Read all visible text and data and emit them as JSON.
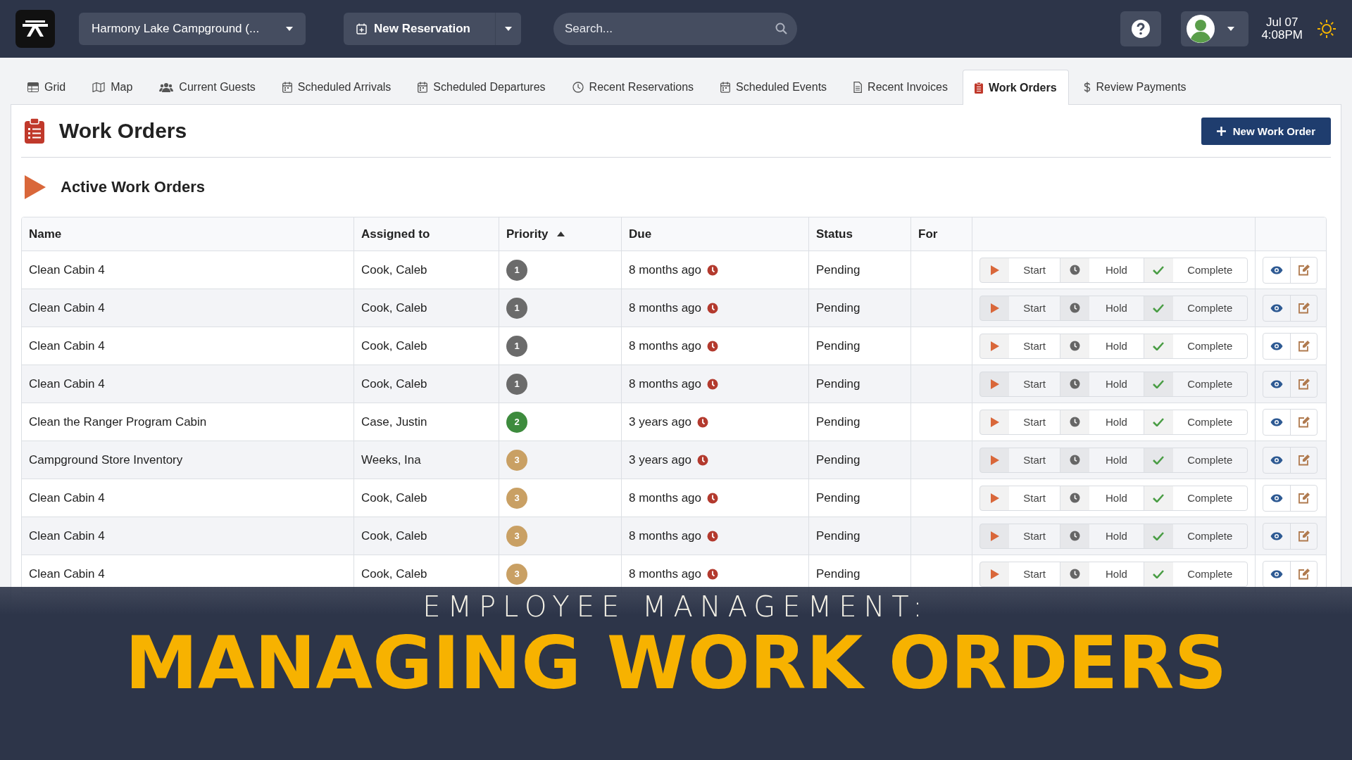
{
  "topbar": {
    "campground": "Harmony Lake Campground (...",
    "new_reservation": "New Reservation",
    "search": {
      "placeholder": "Search..."
    },
    "date": "Jul 07",
    "time": "4:08PM"
  },
  "tabs": [
    {
      "label": "Grid",
      "kind": "grid",
      "selected": false
    },
    {
      "label": "Map",
      "kind": "map",
      "selected": false
    },
    {
      "label": "Current Guests",
      "kind": "users",
      "selected": false
    },
    {
      "label": "Scheduled Arrivals",
      "kind": "calendar",
      "selected": false
    },
    {
      "label": "Scheduled Departures",
      "kind": "calendar",
      "selected": false
    },
    {
      "label": "Recent Reservations",
      "kind": "clock",
      "selected": false
    },
    {
      "label": "Scheduled Events",
      "kind": "calendar",
      "selected": false
    },
    {
      "label": "Recent Invoices",
      "kind": "document",
      "selected": false
    },
    {
      "label": "Work Orders",
      "kind": "clipboard",
      "selected": true
    },
    {
      "label": "Review Payments",
      "kind": "dollar",
      "selected": false
    }
  ],
  "page": {
    "title": "Work Orders",
    "new_button": "New Work Order",
    "section_title": "Active Work Orders"
  },
  "table": {
    "columns": [
      "Name",
      "Assigned to",
      "Priority",
      "Due",
      "Status",
      "For"
    ],
    "rows": [
      {
        "name": "Clean Cabin 4",
        "assigned": "Cook, Caleb",
        "priority": "1",
        "color": "#6b6b6b",
        "due": "8 months ago",
        "status": "Pending",
        "actions": [
          "Start",
          "Hold",
          "Complete"
        ]
      },
      {
        "name": "Clean Cabin 4",
        "assigned": "Cook, Caleb",
        "priority": "1",
        "color": "#6b6b6b",
        "due": "8 months ago",
        "status": "Pending",
        "actions": [
          "Start",
          "Hold",
          "Complete"
        ]
      },
      {
        "name": "Clean Cabin 4",
        "assigned": "Cook, Caleb",
        "priority": "1",
        "color": "#6b6b6b",
        "due": "8 months ago",
        "status": "Pending",
        "actions": [
          "Start",
          "Hold",
          "Complete"
        ]
      },
      {
        "name": "Clean Cabin 4",
        "assigned": "Cook, Caleb",
        "priority": "1",
        "color": "#6b6b6b",
        "due": "8 months ago",
        "status": "Pending",
        "actions": [
          "Start",
          "Hold",
          "Complete"
        ]
      },
      {
        "name": "Clean the Ranger Program Cabin",
        "assigned": "Case, Justin",
        "priority": "2",
        "color": "#3d8b3d",
        "due": "3 years ago",
        "status": "Pending",
        "actions": [
          "Start",
          "Hold",
          "Complete"
        ]
      },
      {
        "name": "Campground Store Inventory",
        "assigned": "Weeks, Ina",
        "priority": "3",
        "color": "#c9a064",
        "due": "3 years ago",
        "status": "Pending",
        "actions": [
          "Start",
          "Hold",
          "Complete"
        ]
      },
      {
        "name": "Clean Cabin 4",
        "assigned": "Cook, Caleb",
        "priority": "3",
        "color": "#c9a064",
        "due": "8 months ago",
        "status": "Pending",
        "actions": [
          "Start",
          "Hold",
          "Complete"
        ]
      },
      {
        "name": "Clean Cabin 4",
        "assigned": "Cook, Caleb",
        "priority": "3",
        "color": "#c9a064",
        "due": "8 months ago",
        "status": "Pending",
        "actions": [
          "Start",
          "Hold",
          "Complete"
        ]
      },
      {
        "name": "Clean Cabin 4",
        "assigned": "Cook, Caleb",
        "priority": "3",
        "color": "#c9a064",
        "due": "8 months ago",
        "status": "Pending",
        "actions": [
          "Start",
          "Hold",
          "Complete"
        ]
      }
    ]
  },
  "overlay": {
    "kicker": "EMPLOYEE MANAGEMENT:",
    "headline": "MANAGING WORK ORDERS"
  }
}
